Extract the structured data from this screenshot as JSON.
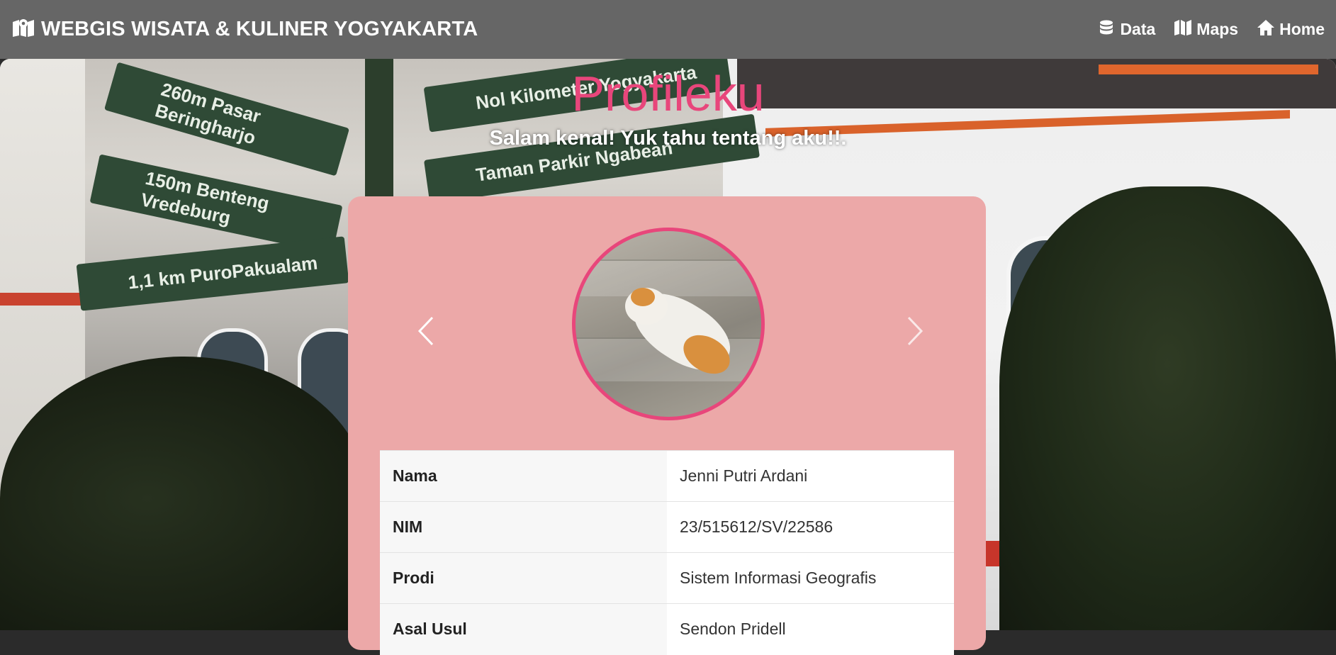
{
  "navbar": {
    "brand": "WEBGIS WISATA & KULINER YOGYAKARTA",
    "links": [
      {
        "label": "Data",
        "icon": "database-icon"
      },
      {
        "label": "Maps",
        "icon": "map-icon"
      },
      {
        "label": "Home",
        "icon": "home-icon"
      }
    ]
  },
  "hero": {
    "title": "Profileku",
    "subtitle": "Salam kenal! Yuk tahu tentang aku!!.",
    "signs": [
      "260m Pasar Beringharjo",
      "150m Benteng Vredeburg",
      "1,1 km PuroPakualam",
      "Nol Kilometer Yogyakarta",
      "Taman Parkir Ngabean"
    ]
  },
  "profile": {
    "photo": "cat-photo",
    "rows": [
      {
        "key": "Nama",
        "value": "Jenni Putri Ardani"
      },
      {
        "key": "NIM",
        "value": "23/515612/SV/22586"
      },
      {
        "key": "Prodi",
        "value": "Sistem Informasi Geografis"
      },
      {
        "key": "Asal Usul",
        "value": "Sendon Pridell"
      }
    ]
  },
  "colors": {
    "navbar": "#666666",
    "accent": "#e8467b",
    "card": "#eca8a8"
  }
}
